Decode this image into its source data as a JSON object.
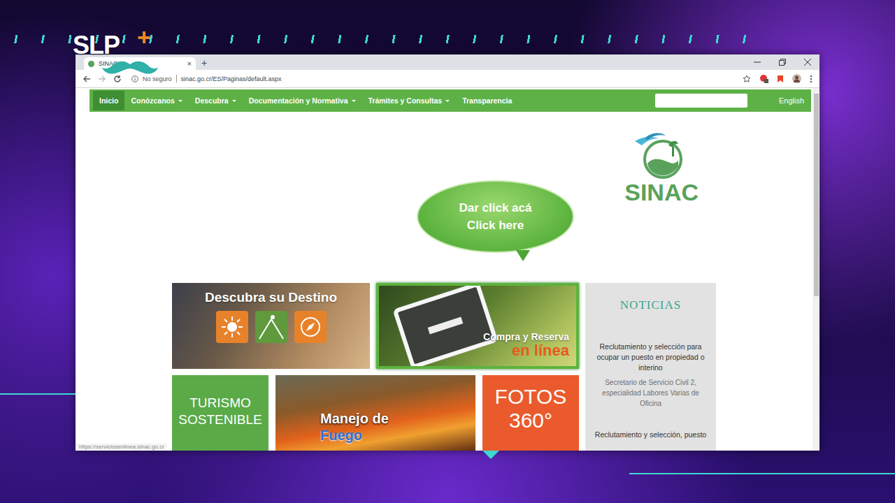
{
  "overlay_logo": {
    "text": "SLP",
    "plus": "+"
  },
  "browser": {
    "tab": {
      "title": "SINAC",
      "close": "×"
    },
    "new_tab": "+",
    "address": {
      "security": "No seguro",
      "url": "sinac.go.cr/ES/Paginas/default.aspx"
    },
    "status_url": "https://serviciosenlinea.sinac.go.cr"
  },
  "nav": {
    "items": [
      {
        "label": "Inicio",
        "selected": true,
        "has_menu": false
      },
      {
        "label": "Conózcanos",
        "selected": false,
        "has_menu": true
      },
      {
        "label": "Descubra",
        "selected": false,
        "has_menu": true
      },
      {
        "label": "Documentación y Normativa",
        "selected": false,
        "has_menu": true
      },
      {
        "label": "Trámites y Consultas",
        "selected": false,
        "has_menu": true
      },
      {
        "label": "Transparencia",
        "selected": false,
        "has_menu": false
      }
    ],
    "search": {
      "value": ""
    },
    "language": "English"
  },
  "logo": {
    "text": "SINAC"
  },
  "callout": {
    "lines": [
      "Dar click acá",
      "Click here"
    ]
  },
  "tiles_top": [
    {
      "kind": "destino",
      "title": "Descubra su Destino",
      "subtitle": "",
      "selected": false
    },
    {
      "kind": "compra",
      "title": "Compra y Reserva",
      "subtitle": "en línea",
      "selected": true
    }
  ],
  "news": {
    "title": "NOTICIAS",
    "items": [
      {
        "text": "Reclutamiento y selección para ocupar un puesto en propiedad o interino",
        "muted": false
      },
      {
        "text": "Secretario de Servicio Civil 2, especialidad Labores Varias de Oficina",
        "muted": true
      },
      {
        "text": "Reclutamiento y selección, puesto",
        "muted": false
      }
    ]
  },
  "tiles_bottom": [
    {
      "kind": "text",
      "title": "TURISMO SOSTENIBLE",
      "subtitle": "",
      "color": "#5aaa48"
    },
    {
      "kind": "photo",
      "title": "Manejo de",
      "subtitle": "Fuego",
      "color": "#8a3a12"
    },
    {
      "kind": "text",
      "title": "FOTOS 360°",
      "subtitle": "",
      "color": "#ea5a2c"
    }
  ]
}
